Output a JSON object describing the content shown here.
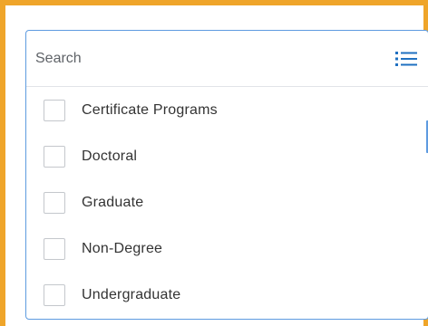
{
  "search": {
    "placeholder": "Search",
    "value": "",
    "icon": "list-icon"
  },
  "options": [
    {
      "label": "Certificate Programs",
      "checked": false
    },
    {
      "label": "Doctoral",
      "checked": false
    },
    {
      "label": "Graduate",
      "checked": false
    },
    {
      "label": "Non-Degree",
      "checked": false
    },
    {
      "label": "Undergraduate",
      "checked": false
    }
  ],
  "colors": {
    "frame_border": "#efa52a",
    "picker_border": "#5e9be0",
    "icon": "#1f70c1",
    "text": "#333333"
  }
}
